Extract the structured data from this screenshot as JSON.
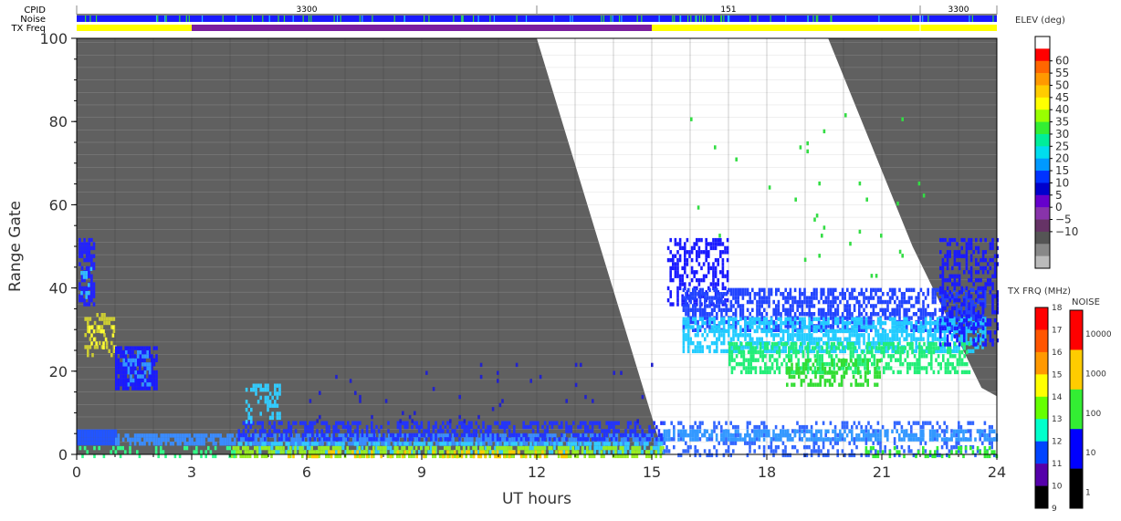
{
  "header": {
    "cpid_label": "CPID",
    "noise_label": "Noise",
    "txfreq_label": "TX Freq",
    "cpid_segments": [
      {
        "label": "3300",
        "start": 0,
        "end": 12
      },
      {
        "label": "151",
        "start": 12,
        "end": 22
      },
      {
        "label": "3300",
        "start": 22,
        "end": 24
      }
    ],
    "txfreq_segments": [
      {
        "start": 0,
        "end": 3,
        "color": "#ffff00"
      },
      {
        "start": 3,
        "end": 15,
        "color": "#7a1fa0"
      },
      {
        "start": 15,
        "end": 24,
        "color": "#ffff00"
      }
    ],
    "noise_color": "#1a1aff"
  },
  "chart_data": {
    "type": "heatmap",
    "xlabel": "UT hours",
    "ylabel": "Range Gate",
    "xlim": [
      0,
      24
    ],
    "ylim": [
      0,
      100
    ],
    "xticks": [
      "0",
      "3",
      "6",
      "9",
      "12",
      "15",
      "18",
      "21",
      "24"
    ],
    "yticks": [
      "0",
      "20",
      "40",
      "60",
      "80",
      "100"
    ],
    "ground_scatter_color": "#606060",
    "regions": [
      {
        "name": "ground-scatter-early",
        "polygon": [
          [
            0,
            100
          ],
          [
            12,
            100
          ],
          [
            15.3,
            0
          ],
          [
            0,
            0
          ]
        ]
      },
      {
        "name": "ground-scatter-late",
        "polygon": [
          [
            19.6,
            100
          ],
          [
            24,
            100
          ],
          [
            24,
            14
          ],
          [
            23.6,
            16
          ],
          [
            21.8,
            50
          ]
        ]
      }
    ],
    "echo_patches": [
      {
        "x0": 0.05,
        "x1": 0.45,
        "y0": 36,
        "y1": 52,
        "color": "#2222ff",
        "density": 0.7
      },
      {
        "x0": 0.1,
        "x1": 0.35,
        "y0": 38,
        "y1": 46,
        "color": "#33bbff",
        "density": 0.3
      },
      {
        "x0": 0.2,
        "x1": 1.0,
        "y0": 24,
        "y1": 34,
        "color": "#cccc33",
        "density": 0.35
      },
      {
        "x0": 0.3,
        "x1": 1.0,
        "y0": 26,
        "y1": 31,
        "color": "#ffff33",
        "density": 0.2
      },
      {
        "x0": 1.0,
        "x1": 2.1,
        "y0": 16,
        "y1": 26,
        "color": "#1a1aff",
        "density": 0.85
      },
      {
        "x0": 1.2,
        "x1": 1.9,
        "y0": 17,
        "y1": 25,
        "color": "#3399ff",
        "density": 0.3
      },
      {
        "x0": 0,
        "x1": 1.0,
        "y0": 3,
        "y1": 6,
        "color": "#2255ff",
        "density": 1.0
      },
      {
        "x0": 1.0,
        "x1": 15.3,
        "y0": 3,
        "y1": 5,
        "color": "#3a8cff",
        "density": 0.75
      },
      {
        "x0": 4.2,
        "x1": 15.3,
        "y0": 4,
        "y1": 8,
        "color": "#2233ff",
        "density": 0.5
      },
      {
        "x0": 4.2,
        "x1": 15.3,
        "y0": 1,
        "y1": 3,
        "color": "#33ccff",
        "density": 0.55
      },
      {
        "x0": 4.0,
        "x1": 15.3,
        "y0": 0,
        "y1": 2,
        "color": "#99ee22",
        "density": 0.55
      },
      {
        "x0": 5.5,
        "x1": 13.0,
        "y0": 0,
        "y1": 1,
        "color": "#ffcc00",
        "density": 0.25
      },
      {
        "x0": 4.4,
        "x1": 5.3,
        "y0": 8,
        "y1": 17,
        "color": "#33ccff",
        "density": 0.35
      },
      {
        "x0": 0,
        "x1": 4.2,
        "y0": 0,
        "y1": 2,
        "color": "#33ff88",
        "density": 0.2
      },
      {
        "x0": 15.4,
        "x1": 17.0,
        "y0": 36,
        "y1": 52,
        "color": "#1a1aff",
        "density": 0.45
      },
      {
        "x0": 15.8,
        "x1": 23.7,
        "y0": 30,
        "y1": 40,
        "color": "#2244ff",
        "density": 0.6
      },
      {
        "x0": 15.8,
        "x1": 23.7,
        "y0": 25,
        "y1": 33,
        "color": "#22ccff",
        "density": 0.6
      },
      {
        "x0": 17.0,
        "x1": 23.3,
        "y0": 20,
        "y1": 27,
        "color": "#22ee77",
        "density": 0.55
      },
      {
        "x0": 18.5,
        "x1": 21.0,
        "y0": 17,
        "y1": 23,
        "color": "#33dd33",
        "density": 0.45
      },
      {
        "x0": 22.5,
        "x1": 24.0,
        "y0": 26,
        "y1": 52,
        "color": "#1a1aff",
        "density": 0.4
      },
      {
        "x0": 15.3,
        "x1": 24.0,
        "y0": 0,
        "y1": 8,
        "color": "#3366ff",
        "density": 0.3
      },
      {
        "x0": 15.3,
        "x1": 24.0,
        "y0": 4,
        "y1": 6,
        "color": "#3399ff",
        "density": 0.6
      },
      {
        "x0": 20.5,
        "x1": 24.0,
        "y0": 0,
        "y1": 2,
        "color": "#33ee33",
        "density": 0.3
      },
      {
        "x0": 6.0,
        "x1": 15.0,
        "y0": 8,
        "y1": 22,
        "color": "#2222cc",
        "density": 0.015
      },
      {
        "x0": 16.0,
        "x1": 23.0,
        "y0": 42,
        "y1": 82,
        "color": "#33dd44",
        "density": 0.01
      }
    ],
    "colorbars": [
      {
        "name": "elev",
        "title": "ELEV (deg)",
        "labels": [
          "60",
          "55",
          "50",
          "45",
          "40",
          "35",
          "30",
          "25",
          "20",
          "15",
          "10",
          "5",
          "0",
          "−5",
          "−10"
        ],
        "colors": [
          "#ffffff",
          "#ff0000",
          "#ff6600",
          "#ff9900",
          "#ffcc00",
          "#ffff00",
          "#99ff00",
          "#33ee33",
          "#00ee99",
          "#00ddee",
          "#0099ff",
          "#0033ff",
          "#0000cc",
          "#6600cc",
          "#8833aa",
          "#663366",
          "#555555",
          "#888888",
          "#bbbbbb"
        ]
      },
      {
        "name": "txfrq",
        "title": "TX FRQ (MHz)",
        "labels": [
          "18",
          "17",
          "16",
          "15",
          "14",
          "13",
          "12",
          "11",
          "10",
          "9"
        ],
        "colors": [
          "#ff0000",
          "#ff5500",
          "#ff9900",
          "#ffff00",
          "#66ff00",
          "#00ffcc",
          "#0044ff",
          "#5500aa",
          "#000000"
        ]
      },
      {
        "name": "noise",
        "title": "NOISE",
        "labels": [
          "10000",
          "1000",
          "100",
          "10",
          "1"
        ],
        "colors": [
          "#ff0000",
          "#ffcc00",
          "#33ee33",
          "#0000ff",
          "#000000"
        ]
      }
    ]
  }
}
